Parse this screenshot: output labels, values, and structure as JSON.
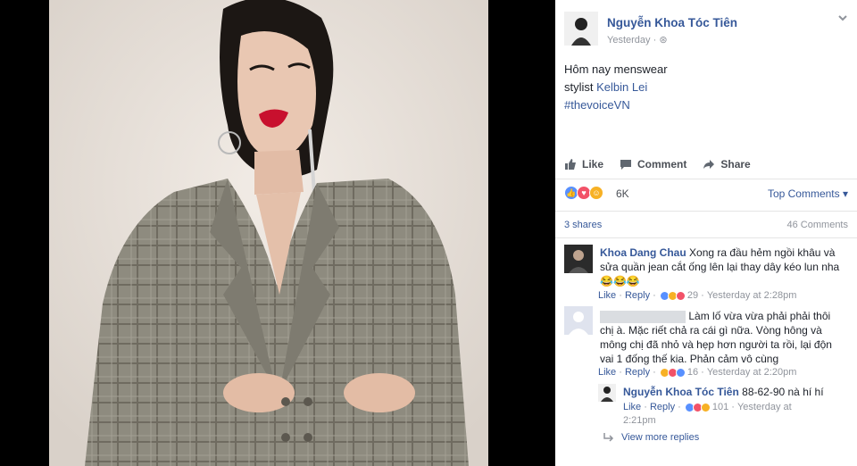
{
  "post": {
    "author": "Nguyễn Khoa Tóc Tiên",
    "time": "Yesterday",
    "text_line1": "Hôm nay menswear",
    "text_line2_prefix": "stylist ",
    "text_line2_link": "Kelbin Lei",
    "hashtag": "#thevoiceVN"
  },
  "actions": {
    "like": "Like",
    "comment": "Comment",
    "share": "Share"
  },
  "reactions": {
    "count": "6K",
    "sort_label": "Top Comments",
    "shares": "3 shares",
    "comments": "46 Comments"
  },
  "comments": [
    {
      "author": "Khoa Dang Chau",
      "text_line1": "Xong ra đầu hẻm ngồi khâu và",
      "text_line2": "sửa quần jean cắt ống lên lại thay dây kéo lun nha",
      "emoji": "😂😂😂",
      "like": "Like",
      "reply": "Reply",
      "reactions": "29",
      "time": "Yesterday at 2:28pm"
    },
    {
      "text_line1": "Làm lố vừa vừa phải phải thôi",
      "text_line2": "chị à. Mặc riết chả ra cái gì nữa. Vòng hông và",
      "text_line3": "mông chị đã nhỏ và hẹp hơn người ta rồi, lại độn",
      "text_line4": "vai 1 đống thế kia. Phản cảm vô cùng",
      "like": "Like",
      "reply": "Reply",
      "reactions": "16",
      "time": "Yesterday at 2:20pm"
    }
  ],
  "reply": {
    "author": "Nguyễn Khoa Tóc Tiên",
    "text": "88-62-90 nà hí hí",
    "like": "Like",
    "reply": "Reply",
    "reactions": "101",
    "time_part1": "Yesterday at",
    "time_part2": "2:21pm"
  },
  "view_more": "View more replies",
  "colors": {
    "link": "#365899",
    "muted": "#90949c",
    "like_blue": "#5890ff",
    "love_red": "#f25268",
    "haha_yellow": "#f7b125",
    "lipstick": "#c8102e",
    "suit": "#8c8a7e"
  }
}
